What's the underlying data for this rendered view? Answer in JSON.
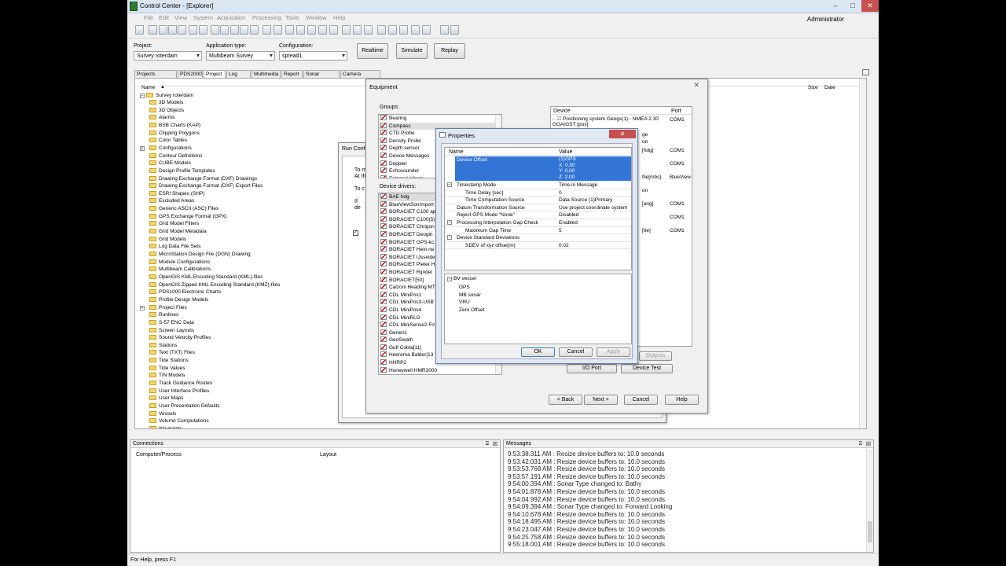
{
  "window": {
    "title": "Control Center - [Explorer]",
    "user": "Administrator"
  },
  "menu": [
    "File",
    "Edit",
    "View",
    "System",
    "Acquisition",
    "Processing",
    "Tools",
    "Window",
    "Help"
  ],
  "top": {
    "project_label": "Project:",
    "project_value": "Survey roterdam",
    "apptype_label": "Application type:",
    "apptype_value": "Multibeam Survey",
    "config_label": "Configuration:",
    "config_value": "spread1",
    "realtime": "Realtime",
    "simulate": "Simulate",
    "replay": "Replay"
  },
  "tabs": [
    "Projects Common",
    "PDS2000",
    "Project",
    "Log Data",
    "Multimedia",
    "Report",
    "Sonar Targets",
    "Camera Images"
  ],
  "explorer": {
    "col_name": "Name",
    "col_size": "Size",
    "col_date": "Date",
    "root": "Survey roterdam",
    "items": [
      "3D Models",
      "3D Objects",
      "Alarms",
      "BSB Charts (KAP)",
      "Clipping Polygons",
      "Color Tables",
      "Configurations",
      "Contour Definitions",
      "CUBE Models",
      "Design Profile Templates",
      "Drawing Exchange Format (DXF) Drawings",
      "Drawing Exchange Format (DXF) Export Files",
      "ESRI Shapes (SHP)",
      "Excluded Areas",
      "Generic ASCII (ASC) Files",
      "GPS Exchange Format (GPX)",
      "Grid Model Filters",
      "Grid Model Metadata",
      "Grid Models",
      "Log Data File Sets",
      "MicroStation Design File (DGN) Drawing",
      "Module Configurations",
      "Multibeam Calibrations",
      "OpenGIS KML Encoding Standard (KML)-files",
      "OpenGIS Zipped KML Encoding Standard (KMZ)-files",
      "PDS1000 Electronic Charts",
      "Profile Design Models",
      "Project Files",
      "Runlines",
      "S-57 ENC Data",
      "Screen Layouts",
      "Sound Velocity Profiles",
      "Stations",
      "Text (TXT) Files",
      "Tide Stations",
      "Tide Values",
      "TIN Models",
      "Track Guidance Routes",
      "User Interface Profiles",
      "User Maps",
      "User Presentation Defaults",
      "Vessels",
      "Volume Computations",
      "Waypoints"
    ]
  },
  "runconfig": {
    "title": "Run Confi",
    "lines": [
      "To m",
      "At th",
      "To c",
      "If",
      "de"
    ]
  },
  "equipment": {
    "title": "Equipment",
    "groups_label": "Groups:",
    "groups": [
      "Bearing",
      "Compass",
      "CTD Probe",
      "Density Probe",
      "Depth sensor",
      "Device Messages",
      "Doppler",
      "Echosounder",
      "External inform"
    ],
    "drivers_label": "Device drivers:",
    "drivers": [
      "BAE hdg",
      "BlueViewSonImport",
      "BORACIET C100 ap",
      "BORACIET C100(5)",
      "BORACIET Chrigon",
      "BORACIET Deogin",
      "BORACIET GPS-kc",
      "BORACIET Hein ne",
      "BORACIET IJsselde",
      "BORACIET Pieter H",
      "BORACIET Rijndel",
      "BORACIET[50]",
      "Calzoni Heading MT",
      "CDL MiniPos1",
      "CDL MiniPos3-USB",
      "CDL MiniPos4",
      "CDL MiniRLG",
      "CDL MiniSense2 Fo",
      "Generic",
      "GeoSwath",
      "Gulf Cobla[11]",
      "Heerema Balder[13",
      "HHRP2",
      "Honeywell HMR3000"
    ],
    "device_col": "Device",
    "port_col": "Port",
    "devices": [
      {
        "name": "Positioning system Geogs(1) - NMEA 2.30 GGA/GST [pos]",
        "port": "COM1"
      },
      {
        "name": "ge",
        "port": ""
      },
      {
        "name": "on",
        "port": ""
      },
      {
        "name": "[hdg]",
        "port": "COM1"
      },
      {
        "name": "",
        "port": "COM1"
      },
      {
        "name": "file[mbs]",
        "port": "BlueView"
      },
      {
        "name": "on",
        "port": ""
      },
      {
        "name": "[ang]",
        "port": "COM1"
      },
      {
        "name": "",
        "port": "COM1"
      },
      {
        "name": "[tte]",
        "port": "COM1"
      }
    ],
    "outputs": "Outputs",
    "io_port": "I/O Port",
    "device_test": "Device Test",
    "back": "< Back",
    "next": "Next >",
    "cancel": "Cancel",
    "help": "Help"
  },
  "properties": {
    "title": "Properties",
    "name_col": "Name",
    "value_col": "Value",
    "selected_name": "Device Offset",
    "selected_value": [
      "(1)GPS",
      "X: 0.50",
      "Y: 0.00",
      "Z: 2.00"
    ],
    "rows": [
      {
        "name": "Timestamp Mode",
        "value": "Time in Message",
        "indent": 0,
        "exp": true
      },
      {
        "name": "Time Delay [sec]",
        "value": "0",
        "indent": 1,
        "exp": false
      },
      {
        "name": "Time Computation Source",
        "value": "Data Source  (1)Primary",
        "indent": 1,
        "exp": false
      },
      {
        "name": "Datum Transformation Source",
        "value": "Use project coordinate system",
        "indent": 0,
        "exp": false
      },
      {
        "name": "Reject GPS Mode \"None\"",
        "value": "Disabled",
        "indent": 0,
        "exp": false
      },
      {
        "name": "Processing Interpolation Gap Check",
        "value": "Enabled",
        "indent": 0,
        "exp": true
      },
      {
        "name": "Maximum Gap Time",
        "value": "5",
        "indent": 1,
        "exp": false
      },
      {
        "name": "Device Standard Deviations",
        "value": "",
        "indent": 0,
        "exp": true
      },
      {
        "name": "SDEV of xyz offset(m)",
        "value": "0.02",
        "indent": 1,
        "exp": false
      }
    ],
    "vessel": {
      "root": "BV vessel",
      "children": [
        "GPS",
        "MB sonar",
        "VRU",
        "Zero Offset"
      ]
    },
    "ok": "OK",
    "cancel": "Cancel",
    "apply": "Apply"
  },
  "connections": {
    "title": "Connections",
    "col1": "Computer/Process",
    "col2": "Layout"
  },
  "messages": {
    "title": "Messages",
    "lines": [
      "9:53:38.311 AM : Resize device buffers to: 10.0 seconds",
      "9:53:42.031 AM : Resize device buffers to: 10.0 seconds",
      "9:53:53.768 AM : Resize device buffers to: 10.0 seconds",
      "9:53:57.191 AM : Resize device buffers to: 10.0 seconds",
      "9:54:00.394 AM : Sonar Type changed to: Bathy",
      "9:54:01.878 AM : Resize device buffers to: 10.0 seconds",
      "9:54:04.992 AM : Resize device buffers to: 10.0 seconds",
      "9:54:09.394 AM : Sonar Type changed to: Forward Looking",
      "9:54:10.678 AM : Resize device buffers to: 10.0 seconds",
      "9:54:18.495 AM : Resize device buffers to: 10.0 seconds",
      "9:54:23.047 AM : Resize device buffers to: 10.0 seconds",
      "9:54:25.758 AM : Resize device buffers to: 10.0 seconds",
      "9:55:18.001 AM : Resize device buffers to: 10.0 seconds"
    ]
  },
  "status": "For Help, press F1"
}
